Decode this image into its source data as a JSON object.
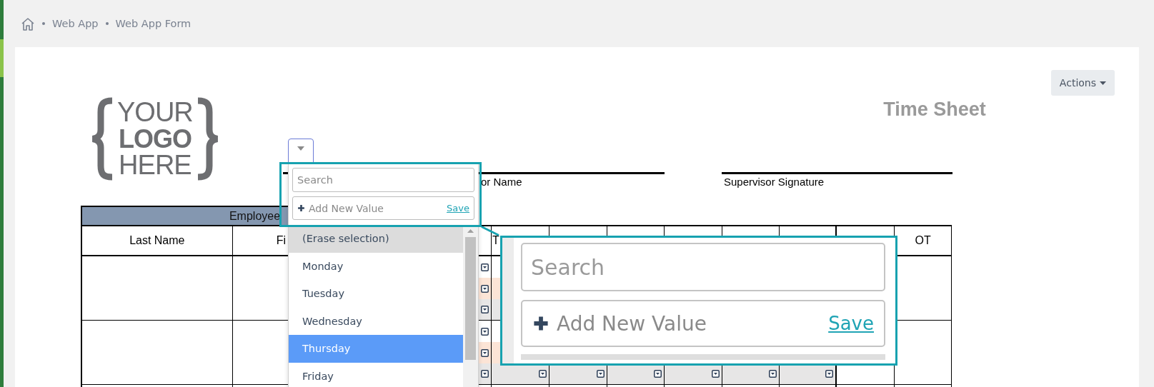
{
  "breadcrumb": {
    "items": [
      {
        "label": "Web App"
      },
      {
        "label": "Web App Form"
      }
    ]
  },
  "logo": {
    "lines": [
      "YOUR",
      "LOGO",
      "HERE"
    ]
  },
  "form": {
    "title": "Time Sheet",
    "actions_button": "Actions",
    "signature_labels": [
      "or Name",
      "Supervisor Signature"
    ]
  },
  "table": {
    "group_heading": "Employee",
    "headings": {
      "column_1": "Last Name",
      "column_2": "Fi",
      "column_5": "T",
      "column_12": "OT"
    }
  },
  "dropdown": {
    "search_placeholder": "Search",
    "add_placeholder": "Add New Value",
    "save_link": "Save",
    "options": [
      {
        "label": "(Erase selection)",
        "highlighted": true,
        "selected": false
      },
      {
        "label": "Monday",
        "highlighted": false,
        "selected": false
      },
      {
        "label": "Tuesday",
        "highlighted": false,
        "selected": false
      },
      {
        "label": "Wednesday",
        "highlighted": false,
        "selected": false
      },
      {
        "label": "Thursday",
        "highlighted": false,
        "selected": true
      },
      {
        "label": "Friday",
        "highlighted": false,
        "selected": false
      }
    ]
  },
  "magnified_inset": {
    "search_placeholder": "Search",
    "add_placeholder": "Add New Value",
    "save_link": "Save"
  }
}
